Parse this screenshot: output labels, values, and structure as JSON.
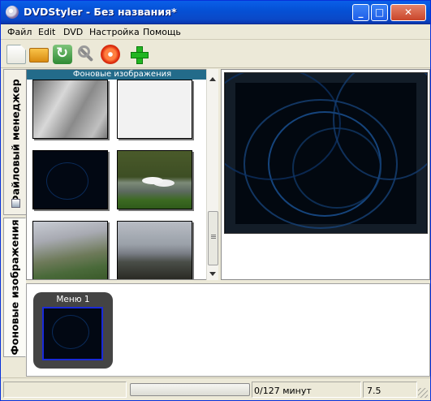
{
  "window": {
    "title": "DVDStyler - Без названия*",
    "controls": {
      "minimize": "_",
      "maximize": "□",
      "close": "✕"
    }
  },
  "menubar": {
    "items": [
      "Файл",
      "Edit",
      "DVD",
      "Настройка",
      "Помощь"
    ]
  },
  "toolbar": {
    "buttons": [
      {
        "icon": "new-document-icon"
      },
      {
        "icon": "open-folder-icon"
      },
      {
        "icon": "save-icon"
      },
      {
        "icon": "settings-wrench-icon"
      },
      {
        "icon": "burn-disc-icon"
      },
      {
        "icon": "add-plus-icon"
      }
    ]
  },
  "side_tabs": {
    "file_manager": "Файловый менеджер",
    "backgrounds": "Фоновые изображения"
  },
  "backgrounds_panel": {
    "header": "Фоновые изображения",
    "thumbnails": [
      {
        "name": "gray-gradient"
      },
      {
        "name": "white-texture"
      },
      {
        "name": "dark-blue-swirl"
      },
      {
        "name": "swans-on-lake"
      },
      {
        "name": "palm-leaves"
      },
      {
        "name": "mountain-haze"
      }
    ]
  },
  "menus_panel": {
    "menus": [
      {
        "label": "Меню 1"
      }
    ]
  },
  "status": {
    "progress_fraction": 0.0,
    "duration_text": "0/127 минут",
    "disc_size": "7.5"
  },
  "colors": {
    "titlebar": "#0551d6",
    "panel_header": "#236b8a",
    "preview_bg": "#020810",
    "menu_selection": "#1a2ad8"
  }
}
